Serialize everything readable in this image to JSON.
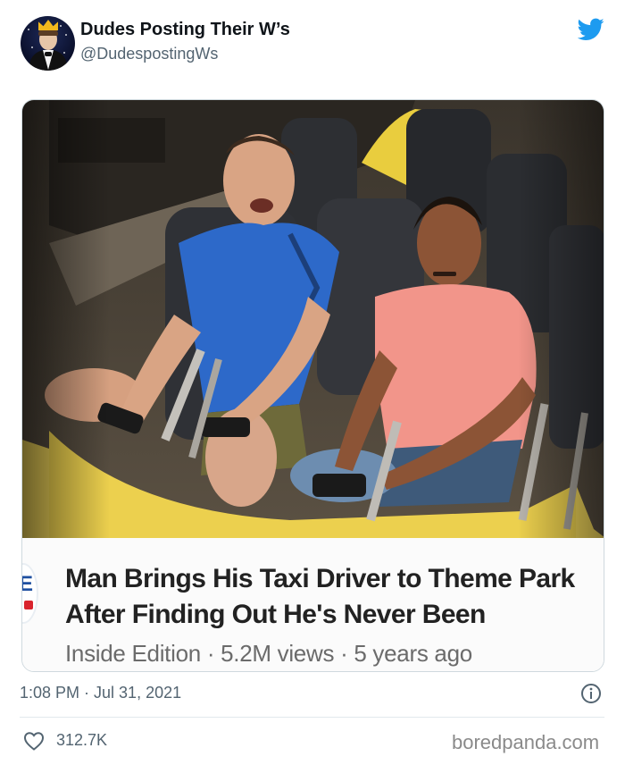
{
  "tweet": {
    "display_name": "Dudes Posting Their W’s",
    "handle": "@DudespostingWs",
    "timestamp": "1:08 PM · Jul 31, 2021",
    "likes": "312.7K"
  },
  "media": {
    "headline_line1": "Man Brings His Taxi Driver to Theme Park",
    "headline_line2": "After Finding Out He's Never Been",
    "subtitle": "Inside Edition · 5.2M views · 5 years ago",
    "logo_letter": "E"
  },
  "watermark": "boredpanda.com",
  "colors": {
    "twitter_blue": "#1d9bf0",
    "muted_text": "#536471",
    "coaster_yellow": "#f1d65a"
  },
  "icons": {
    "brand": "twitter-bird-icon",
    "info": "info-icon",
    "like": "heart-outline-icon"
  }
}
